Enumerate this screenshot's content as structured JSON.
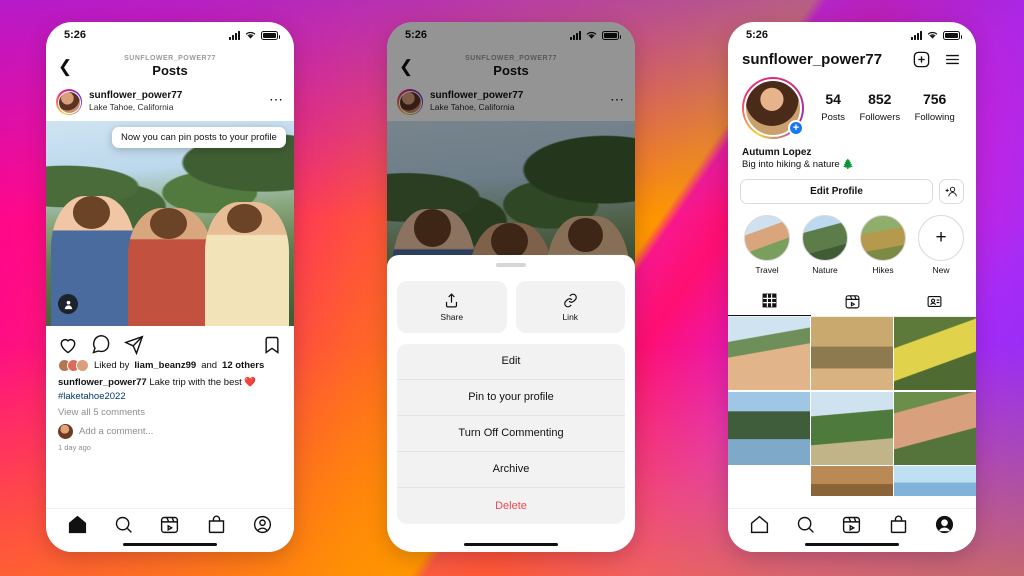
{
  "background": {
    "colors": [
      "#FF0090",
      "#FF9500",
      "#7B2FF7",
      "#FF0050"
    ]
  },
  "phone1": {
    "status": {
      "time": "5:26",
      "signal_icon": "cellular-bars-icon",
      "wifi_icon": "wifi-icon",
      "battery_icon": "battery-icon"
    },
    "nav": {
      "back_icon": "chevron-left-icon",
      "subtitle": "SUNFLOWER_POWER77",
      "title": "Posts"
    },
    "post": {
      "username": "sunflower_power77",
      "location": "Lake Tahoe, California",
      "more_icon": "more-options-icon",
      "tagged_people_icon": "tagged-people-icon",
      "tooltip": "Now you can pin posts to your profile",
      "actions": {
        "like_icon": "heart-icon",
        "comment_icon": "comment-icon",
        "share_icon": "share-icon",
        "save_icon": "bookmark-icon"
      },
      "likes_prefix": "Liked by",
      "likes_user": "liam_beanz99",
      "likes_suffix": "and",
      "likes_others": "12 others",
      "caption_user": "sunflower_power77",
      "caption_text": " Lake trip with the best ❤️",
      "caption_hashtag": "#laketahoe2022",
      "view_comments": "View all 5 comments",
      "add_comment_placeholder": "Add a comment...",
      "timestamp": "1 day ago"
    },
    "tabbar": {
      "home": "home-icon",
      "search": "search-icon",
      "reels": "reels-icon",
      "shop": "shop-icon",
      "profile": "profile-icon"
    }
  },
  "phone2": {
    "status": {
      "time": "5:26"
    },
    "nav": {
      "subtitle": "SUNFLOWER_POWER77",
      "title": "Posts"
    },
    "post": {
      "username": "sunflower_power77",
      "location": "Lake Tahoe, California"
    },
    "sheet": {
      "share_label": "Share",
      "share_icon": "share-upload-icon",
      "link_label": "Link",
      "link_icon": "link-chain-icon",
      "items": [
        {
          "label": "Edit",
          "danger": false
        },
        {
          "label": "Pin to your profile",
          "danger": false
        },
        {
          "label": "Turn Off Commenting",
          "danger": false
        },
        {
          "label": "Archive",
          "danger": false
        },
        {
          "label": "Delete",
          "danger": true
        }
      ],
      "danger_color": "#ED4956"
    }
  },
  "phone3": {
    "status": {
      "time": "5:26"
    },
    "header": {
      "username": "sunflower_power77",
      "add_icon": "new-post-icon",
      "menu_icon": "hamburger-menu-icon"
    },
    "stats": [
      {
        "value": "54",
        "label": "Posts"
      },
      {
        "value": "852",
        "label": "Followers"
      },
      {
        "value": "756",
        "label": "Following"
      }
    ],
    "bio": {
      "name": "Autumn Lopez",
      "description": "Big into hiking & nature 🌲"
    },
    "buttons": {
      "edit_profile": "Edit Profile",
      "add_person_icon": "add-person-icon"
    },
    "highlights": [
      {
        "label": "Travel"
      },
      {
        "label": "Nature"
      },
      {
        "label": "Hikes"
      },
      {
        "label": "New"
      }
    ],
    "tabs": [
      {
        "icon": "grid-icon",
        "active": true
      },
      {
        "icon": "reels-icon",
        "active": false
      },
      {
        "icon": "tagged-icon",
        "active": false
      }
    ],
    "tabbar": {
      "home": "home-icon",
      "search": "search-icon",
      "reels": "reels-icon",
      "shop": "shop-icon",
      "profile": "profile-icon"
    }
  }
}
